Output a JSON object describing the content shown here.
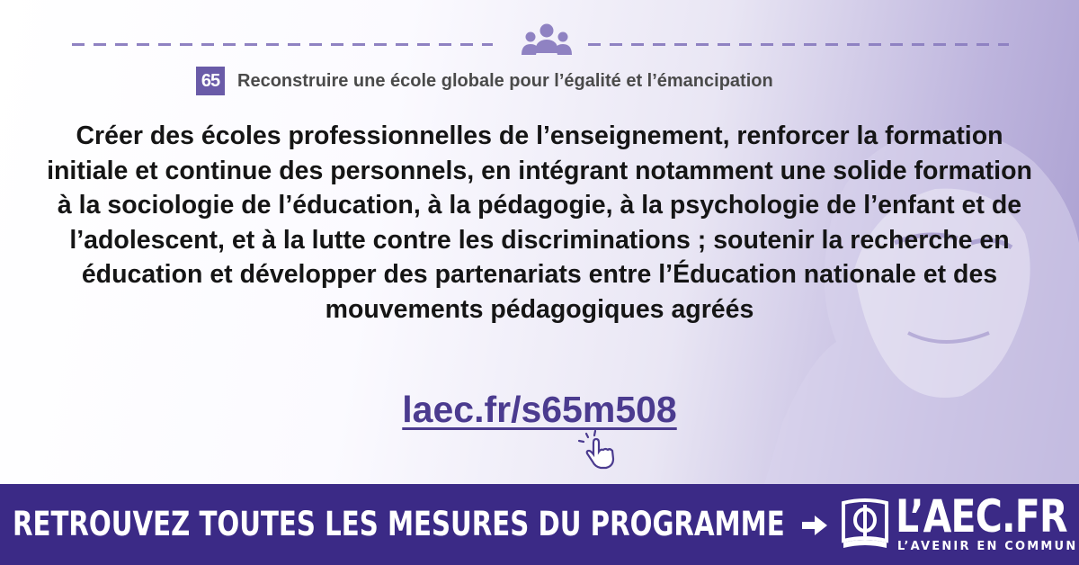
{
  "header": {
    "icon": "group-people-icon",
    "measure_number": "65",
    "section_title": "Reconstruire une école globale pour l’égalité et l’émancipation"
  },
  "main": {
    "measure_text": "Créer des écoles professionnelles de l’enseignement, renforcer la formation initiale et continue des personnels, en intégrant notamment une solide formation à la sociologie de l’éducation, à la pédagogie, à la psychologie de l’enfant et de l’adolescent, et à la lutte contre les discriminations ; soutenir la recherche en éducation et développer des partenariats entre l’Éducation nationale et des mouvements pédagogiques agréés",
    "link_text": "laec.fr/s65m508",
    "link_icon": "hand-click-icon"
  },
  "footer": {
    "cta_text": "RETROUVEZ TOUTES LES MESURES DU PROGRAMME",
    "arrow_icon": "arrow-right-icon",
    "logo_icon": "phi-book-emblem-icon",
    "logo_name": "L’AEC.FR",
    "logo_tagline": "L’AVENIR EN COMMUN"
  },
  "colors": {
    "accent": "#6a5ba8",
    "footer_background": "#3b2a86",
    "link": "#4b3b8f",
    "text": "#151515"
  }
}
